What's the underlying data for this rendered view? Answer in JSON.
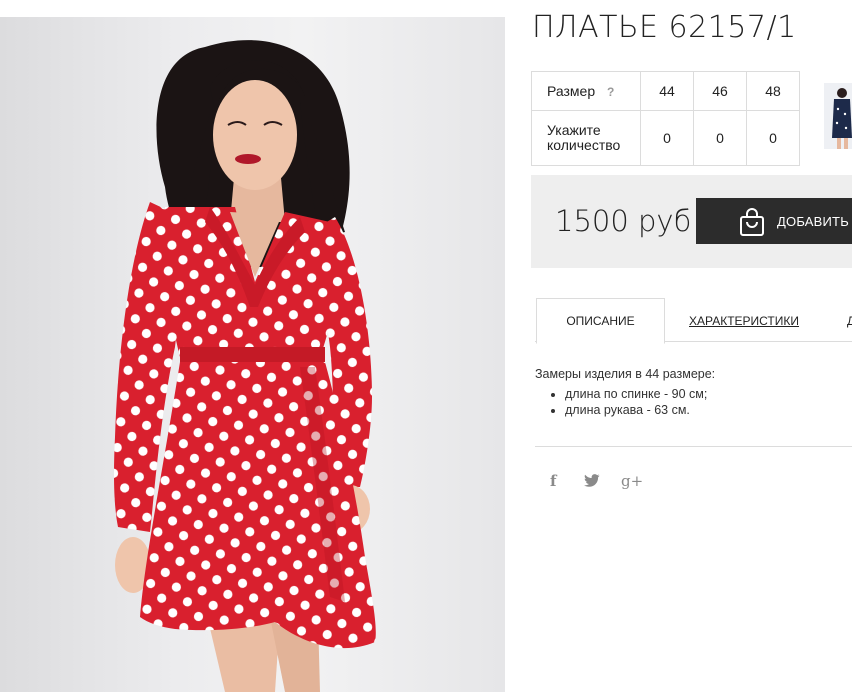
{
  "product": {
    "title": "ПЛАТЬЕ 62157/1",
    "photo": {
      "icon": "product-photo-red-polka-dot-dress"
    }
  },
  "sizes": {
    "label": "Размер",
    "help": "?",
    "values": [
      "44",
      "46",
      "48"
    ],
    "qty_label_line1": "Укажите",
    "qty_label_line2": "количество",
    "quantities": [
      "0",
      "0",
      "0"
    ]
  },
  "price": {
    "value": "1500 руб",
    "cart_button": "ДОБАВИТЬ В",
    "cart_icon": "shopping-bag-icon"
  },
  "tabs": [
    {
      "label": "ОПИСАНИЕ",
      "active": true
    },
    {
      "label": "ХАРАКТЕРИСТИКИ",
      "active": false
    },
    {
      "label": "Д",
      "active": false
    }
  ],
  "description": {
    "intro": "Замеры изделия в 44 размере:",
    "items": [
      "длина по спинке - 90 см;",
      "длина рукава - 63 см."
    ]
  },
  "social": [
    {
      "icon": "facebook-icon",
      "glyph": "f"
    },
    {
      "icon": "twitter-icon",
      "glyph": "🐦"
    },
    {
      "icon": "google-plus-icon",
      "glyph": "g+"
    }
  ],
  "colors": {
    "dress_red": "#d9202e",
    "button_dark": "#2c2c2c",
    "price_bg": "#eeeeee"
  }
}
